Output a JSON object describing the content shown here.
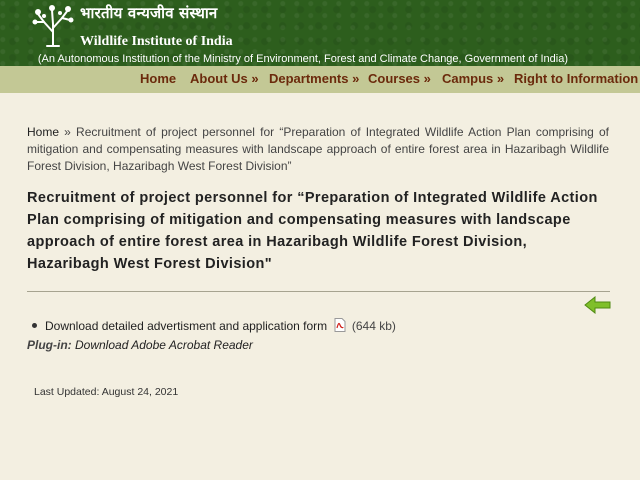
{
  "header": {
    "hindi_title": "भारतीय वन्यजीव संस्थान",
    "english_title": "Wildlife Institute of India",
    "subtitle": "(An Autonomous Institution of the Ministry of Environment, Forest and Climate Change, Government of India)"
  },
  "nav": {
    "items": [
      "Home",
      "About Us »",
      "Departments »",
      "Courses »",
      "Campus »",
      "Right to Information »"
    ]
  },
  "breadcrumb": {
    "home": "Home",
    "separator": " » ",
    "current": "Recruitment of project personnel for “Preparation of Integrated Wildlife Action Plan comprising of mitigation and compensating measures with landscape approach of entire forest area in Hazaribagh Wildlife Forest Division, Hazaribagh West Forest Division”"
  },
  "page_title": "Recruitment of project personnel for “Preparation of Integrated Wildlife Action Plan comprising of mitigation and compensating measures with landscape approach of entire forest area in Hazaribagh Wildlife Forest Division, Hazaribagh West Forest Division\"",
  "download": {
    "label": "Download detailed advertisment and application form",
    "size": "(644 kb)"
  },
  "plugin": {
    "label": "Plug-in:",
    "link": "Download Adobe Acrobat Reader"
  },
  "last_updated": "Last Updated: August 24, 2021",
  "colors": {
    "header_bg": "#2d5e1d",
    "nav_bg": "#c3c895",
    "nav_text": "#6b2a0c",
    "page_bg": "#f3efe1",
    "back_arrow": "#7fbf2a"
  },
  "icons": [
    "tree-logo-icon",
    "pdf-icon",
    "back-arrow-icon"
  ]
}
